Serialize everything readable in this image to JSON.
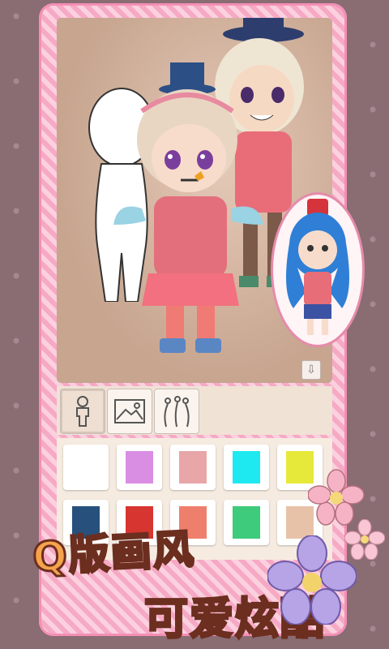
{
  "promo": {
    "line1": "Q版画风",
    "line2": "可爱炫酷"
  },
  "controls": {
    "settings_icon": "gear-icon",
    "close_icon": "close-icon",
    "sound_icon": "speaker-icon",
    "scroll_down_icon": "arrow-down-icon",
    "scroll_down_glyph": "⇩"
  },
  "toolbar": {
    "tools": [
      {
        "name": "body-tool",
        "icon": "body-icon",
        "active": true
      },
      {
        "name": "background-tool",
        "icon": "landscape-icon",
        "active": false
      },
      {
        "name": "effects-tool",
        "icon": "sparkles-icon",
        "active": false
      }
    ]
  },
  "palette": {
    "colors": [
      "#ffffff",
      "#d98ee3",
      "#e8a6a9",
      "#1fe9f0",
      "#e6e93a",
      "#27517c",
      "#d7352f",
      "#ef7f6d",
      "#3ecb7b",
      "#e8c2a8"
    ]
  },
  "colors": {
    "frame": "#f6a9c4",
    "stage": "#c8a893",
    "promo_text": "#f5a34c",
    "promo_outline": "#6b2e1f"
  }
}
